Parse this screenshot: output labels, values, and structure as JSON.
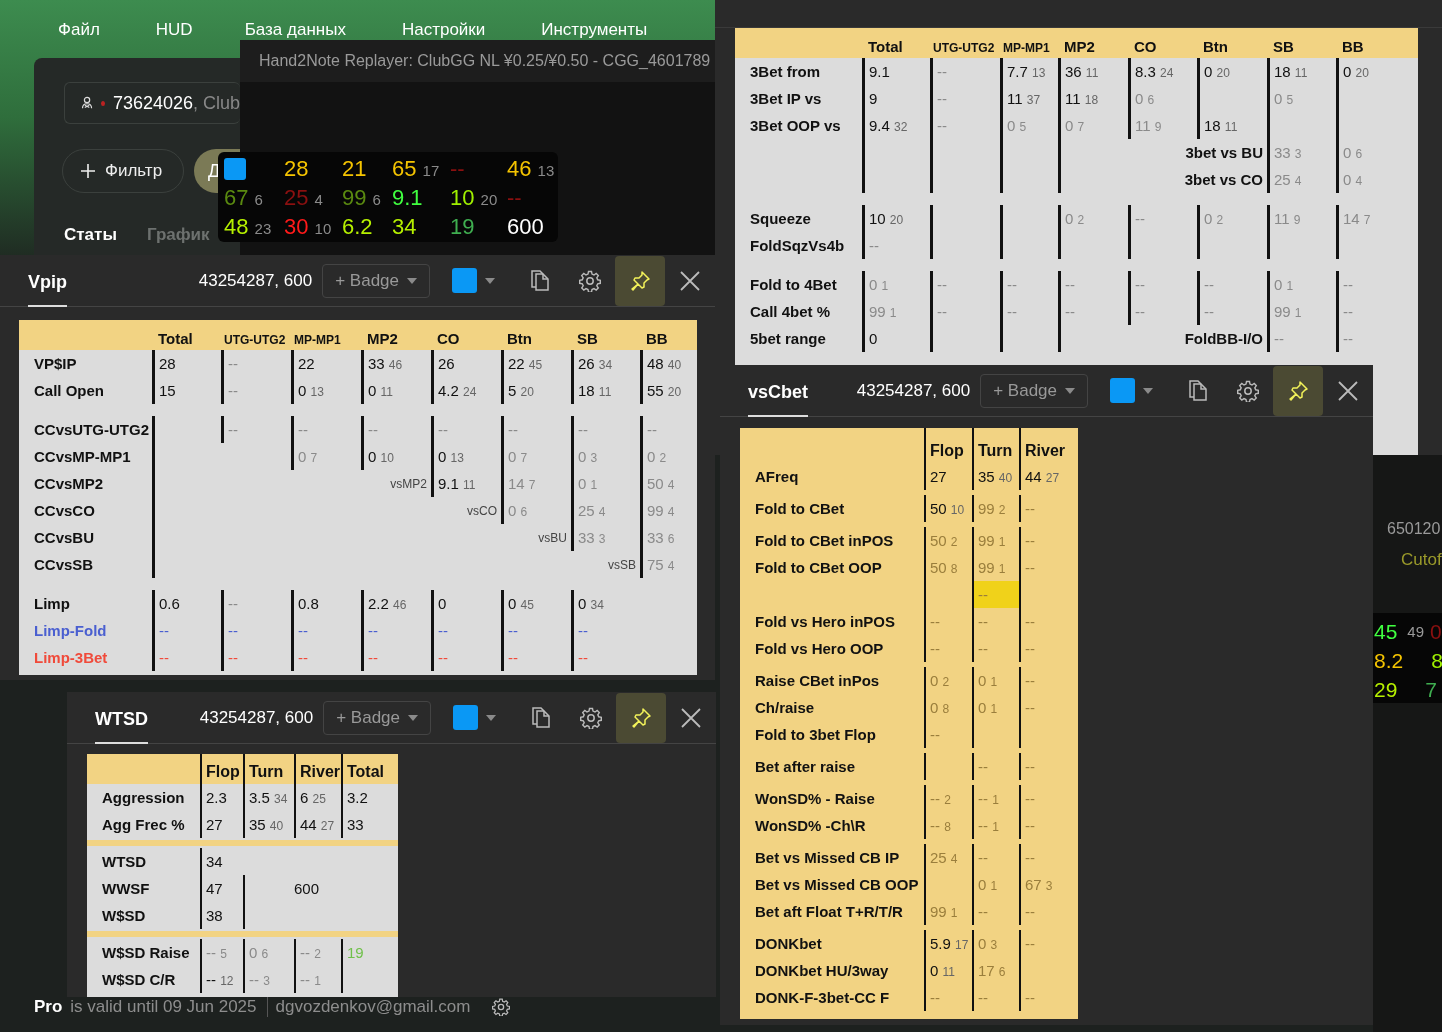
{
  "menu": [
    "Файл",
    "HUD",
    "База данных",
    "Настройки",
    "Инструменты"
  ],
  "player_panel": {
    "search": {
      "value": "73624026",
      "suffix": ", Club"
    },
    "filter_button": "Фильтр",
    "cut_button": "Д",
    "tabs": [
      {
        "label": "Статы",
        "selected": true
      },
      {
        "label": "График",
        "selected": false
      }
    ]
  },
  "replayer": {
    "title": "Hand2Note Replayer: ClubGG NL ¥0.25/¥0.50 - CGG_4601789"
  },
  "hud_popup": {
    "rows": [
      [
        {
          "kind": "swatch",
          "color": "#0a98f5"
        },
        {
          "kind": "stat",
          "v": "28",
          "color": "#f5c400"
        },
        {
          "kind": "stat",
          "v": "21",
          "color": "#f5c400"
        },
        {
          "kind": "stat",
          "v": "65",
          "n": "17",
          "color": "#f5c400"
        },
        {
          "kind": "stat",
          "v": "--",
          "color": "#8b1010"
        },
        {
          "kind": "stat",
          "v": "46",
          "n": "13",
          "color": "#f5c400"
        }
      ],
      [
        {
          "kind": "stat",
          "v": "67",
          "n": "6",
          "color": "#5a8a10"
        },
        {
          "kind": "stat",
          "v": "25",
          "n": "4",
          "color": "#8b1010"
        },
        {
          "kind": "stat",
          "v": "99",
          "n": "6",
          "color": "#5a8a10"
        },
        {
          "kind": "stat",
          "v": "9.1",
          "color": "#40ff40"
        },
        {
          "kind": "stat",
          "v": "10",
          "n": "20",
          "color": "#a0f000"
        },
        {
          "kind": "stat",
          "v": "--",
          "color": "#8b1010"
        }
      ],
      [
        {
          "kind": "stat",
          "v": "48",
          "n": "23",
          "color": "#b6f000"
        },
        {
          "kind": "stat",
          "v": "30",
          "n": "10",
          "color": "#ff1a1a"
        },
        {
          "kind": "stat",
          "v": "6.2",
          "color": "#b6f000"
        },
        {
          "kind": "stat",
          "v": "34",
          "color": "#b6f000"
        },
        {
          "kind": "stat",
          "v": "19",
          "color": "#3fae50"
        },
        {
          "kind": "stat",
          "v": "600",
          "color": "#ffffff"
        }
      ]
    ]
  },
  "background_hud": {
    "id": "650120",
    "position": "Cutof",
    "rows": [
      [
        {
          "v": "45",
          "color": "#40ff40"
        },
        {
          "v": "49",
          "color": "#9a9a9a"
        },
        {
          "v": "0",
          "color": "#8b1010"
        }
      ],
      [
        {
          "v": "8.2",
          "color": "#f5c400"
        },
        {
          "v": "8",
          "color": "#a0f000"
        }
      ],
      [
        {
          "v": "29",
          "color": "#b6f000"
        },
        {
          "v": "7",
          "color": "#3fae50"
        }
      ]
    ]
  },
  "windows": [
    {
      "table": {
        "columns": [
          {
            "label": "Total"
          },
          {
            "label": "UTG-UTG2"
          },
          {
            "label": "MP-MP1"
          },
          {
            "label": "MP2"
          },
          {
            "label": "CO"
          },
          {
            "label": "Btn"
          },
          {
            "label": "SB"
          },
          {
            "label": "BB"
          }
        ],
        "groups": [
          [
            {
              "label": "3Bet from",
              "cells": [
                {
                  "v": "9.1",
                  "dim": false
                },
                {
                  "v": "--",
                  "dim": true
                },
                {
                  "v": "7.7",
                  "n": "13",
                  "dim": false
                },
                {
                  "v": "36",
                  "n": "11",
                  "dim": false
                },
                {
                  "v": "8.3",
                  "n": "24",
                  "dim": false
                },
                {
                  "v": "0",
                  "n": "20",
                  "dim": false
                },
                {
                  "v": "18",
                  "n": "11",
                  "dim": false
                },
                {
                  "v": "0",
                  "n": "20",
                  "dim": false
                }
              ]
            },
            {
              "label": "3Bet IP vs",
              "cells": [
                {
                  "v": "9",
                  "dim": false
                },
                {
                  "v": "--",
                  "dim": true
                },
                {
                  "v": "11",
                  "n": "37",
                  "dim": false
                },
                {
                  "v": "11",
                  "n": "18",
                  "dim": false
                },
                {
                  "v": "0",
                  "n": "6",
                  "dim": true
                },
                {
                  "kind": "blank"
                },
                {
                  "v": "0",
                  "n": "5",
                  "dim": true
                },
                {
                  "kind": "blank"
                }
              ]
            },
            {
              "label": "3Bet OOP vs",
              "cells": [
                {
                  "v": "9.4",
                  "n": "32",
                  "dim": false
                },
                {
                  "v": "--",
                  "dim": true
                },
                {
                  "v": "0",
                  "n": "5",
                  "dim": true
                },
                {
                  "v": "0",
                  "n": "7",
                  "dim": true
                },
                {
                  "v": "11",
                  "n": "9",
                  "dim": true
                },
                {
                  "v": "18",
                  "n": "11",
                  "dim": false
                },
                {
                  "kind": "blank"
                },
                {
                  "kind": "blank"
                }
              ]
            },
            {
              "cells": [
                {
                  "kind": "blank"
                },
                {
                  "kind": "blank"
                },
                {
                  "kind": "blank"
                },
                {
                  "kind": "blank"
                },
                {
                  "kind": "caption",
                  "v": "3bet vs BU"
                },
                {
                  "v": "33",
                  "n": "3",
                  "dim": true
                },
                {
                  "v": "0",
                  "n": "6",
                  "dim": true
                }
              ]
            },
            {
              "cells": [
                {
                  "kind": "blank"
                },
                {
                  "kind": "blank"
                },
                {
                  "kind": "blank"
                },
                {
                  "kind": "blank"
                },
                {
                  "kind": "caption",
                  "v": "3bet vs CO"
                },
                {
                  "v": "25",
                  "n": "4",
                  "dim": true
                },
                {
                  "v": "0",
                  "n": "4",
                  "dim": true
                }
              ]
            }
          ],
          [
            {
              "label": "Squeeze",
              "cells": [
                {
                  "v": "10",
                  "n": "20",
                  "dim": false
                },
                {
                  "kind": "blank"
                },
                {
                  "kind": "blank"
                },
                {
                  "v": "0",
                  "n": "2",
                  "dim": true
                },
                {
                  "v": "--",
                  "dim": true
                },
                {
                  "v": "0",
                  "n": "2",
                  "dim": true
                },
                {
                  "v": "11",
                  "n": "9",
                  "dim": true
                },
                {
                  "v": "14",
                  "n": "7",
                  "dim": true
                }
              ]
            },
            {
              "label": "FoldSqzVs4b",
              "cells": [
                {
                  "v": "--",
                  "dim": true
                },
                {
                  "kind": "blank"
                },
                {
                  "kind": "blank"
                },
                {
                  "kind": "blank"
                },
                {
                  "kind": "blank"
                },
                {
                  "kind": "blank"
                },
                {
                  "kind": "blank"
                },
                {
                  "kind": "blank"
                }
              ]
            }
          ],
          [
            {
              "label": "Fold to 4Bet",
              "cells": [
                {
                  "v": "0",
                  "n": "1",
                  "dim": true
                },
                {
                  "v": "--",
                  "dim": true
                },
                {
                  "v": "--",
                  "dim": true
                },
                {
                  "v": "--",
                  "dim": true
                },
                {
                  "v": "--",
                  "dim": true
                },
                {
                  "v": "--",
                  "dim": true
                },
                {
                  "v": "0",
                  "n": "1",
                  "dim": true
                },
                {
                  "v": "--",
                  "dim": true
                }
              ]
            },
            {
              "label": "Call 4bet %",
              "cells": [
                {
                  "v": "99",
                  "n": "1",
                  "dim": true
                },
                {
                  "v": "--",
                  "dim": true
                },
                {
                  "v": "--",
                  "dim": true
                },
                {
                  "v": "--",
                  "dim": true
                },
                {
                  "v": "--",
                  "dim": true
                },
                {
                  "v": "--",
                  "dim": true
                },
                {
                  "v": "99",
                  "n": "1",
                  "dim": true
                },
                {
                  "v": "--",
                  "dim": true
                }
              ]
            },
            {
              "label": "5bet range",
              "cells": [
                {
                  "v": "0",
                  "dim": false
                },
                {
                  "kind": "blank"
                },
                {
                  "kind": "blank"
                },
                {
                  "kind": "blank"
                },
                {
                  "kind": "caption",
                  "v": "FoldBB-I/O"
                },
                {
                  "v": "--",
                  "dim": true
                },
                {
                  "v": "--",
                  "dim": true
                }
              ]
            }
          ]
        ]
      }
    },
    {
      "header": {
        "title": "Vpip",
        "info": "43254287, 600",
        "badge": "+ Badge",
        "color": "#0a98f5",
        "pinned": true
      },
      "table": {
        "columns": [
          {
            "label": "Total"
          },
          {
            "label": "UTG-UTG2"
          },
          {
            "label": "MP-MP1"
          },
          {
            "label": "MP2"
          },
          {
            "label": "CO"
          },
          {
            "label": "Btn"
          },
          {
            "label": "SB"
          },
          {
            "label": "BB"
          }
        ],
        "groups": [
          [
            {
              "label": "VP$IP",
              "cells": [
                {
                  "v": "28",
                  "dim": false
                },
                {
                  "v": "--",
                  "dim": true
                },
                {
                  "v": "22",
                  "dim": false
                },
                {
                  "v": "33",
                  "n": "46",
                  "dim": false
                },
                {
                  "v": "26",
                  "dim": false
                },
                {
                  "v": "22",
                  "n": "45",
                  "dim": false
                },
                {
                  "v": "26",
                  "n": "34",
                  "dim": false
                },
                {
                  "v": "48",
                  "n": "40",
                  "dim": false
                }
              ]
            },
            {
              "label": "Call Open",
              "cells": [
                {
                  "v": "15",
                  "dim": false
                },
                {
                  "v": "--",
                  "dim": true
                },
                {
                  "v": "0",
                  "n": "13",
                  "dim": false
                },
                {
                  "v": "0",
                  "n": "11",
                  "dim": false
                },
                {
                  "v": "4.2",
                  "n": "24",
                  "dim": false
                },
                {
                  "v": "5",
                  "n": "20",
                  "dim": false
                },
                {
                  "v": "18",
                  "n": "11",
                  "dim": false
                },
                {
                  "v": "55",
                  "n": "20",
                  "dim": false
                }
              ]
            }
          ],
          [
            {
              "label": "CCvsUTG-UTG2",
              "cells": [
                {
                  "kind": "blank"
                },
                {
                  "v": "--",
                  "dim": true
                },
                {
                  "v": "--",
                  "dim": true
                },
                {
                  "v": "--",
                  "dim": true
                },
                {
                  "v": "--",
                  "dim": true
                },
                {
                  "v": "--",
                  "dim": true
                },
                {
                  "v": "--",
                  "dim": true
                },
                {
                  "v": "--",
                  "dim": true
                }
              ]
            },
            {
              "label": "CCvsMP-MP1",
              "cells": [
                {
                  "kind": "blank"
                },
                null,
                {
                  "v": "0",
                  "n": "7",
                  "dim": true
                },
                {
                  "v": "0",
                  "n": "10",
                  "dim": false
                },
                {
                  "v": "0",
                  "n": "13",
                  "dim": false
                },
                {
                  "v": "0",
                  "n": "7",
                  "dim": true
                },
                {
                  "v": "0",
                  "n": "3",
                  "dim": true
                },
                {
                  "v": "0",
                  "n": "2",
                  "dim": true
                }
              ]
            },
            {
              "label": "CCvsMP2",
              "cells": [
                {
                  "kind": "blank"
                },
                null,
                null,
                {
                  "kind": "label",
                  "v": "vsMP2"
                },
                {
                  "v": "9.1",
                  "n": "11",
                  "dim": false
                },
                {
                  "v": "14",
                  "n": "7",
                  "dim": true
                },
                {
                  "v": "0",
                  "n": "1",
                  "dim": true
                },
                {
                  "v": "50",
                  "n": "4",
                  "dim": true
                }
              ]
            },
            {
              "label": "CCvsCO",
              "cells": [
                {
                  "kind": "blank"
                },
                null,
                null,
                null,
                {
                  "kind": "label",
                  "v": "vsCO"
                },
                {
                  "v": "0",
                  "n": "6",
                  "dim": true
                },
                {
                  "v": "25",
                  "n": "4",
                  "dim": true
                },
                {
                  "v": "99",
                  "n": "4",
                  "dim": true
                }
              ]
            },
            {
              "label": "CCvsBU",
              "cells": [
                {
                  "kind": "blank"
                },
                null,
                null,
                null,
                null,
                {
                  "kind": "label",
                  "v": "vsBU"
                },
                {
                  "v": "33",
                  "n": "3",
                  "dim": true
                },
                {
                  "v": "33",
                  "n": "6",
                  "dim": true
                }
              ]
            },
            {
              "label": "CCvsSB",
              "cells": [
                {
                  "kind": "blank"
                },
                null,
                null,
                null,
                null,
                null,
                {
                  "kind": "label",
                  "v": "vsSB"
                },
                {
                  "v": "75",
                  "n": "4",
                  "dim": true
                }
              ]
            }
          ],
          [
            {
              "label": "Limp",
              "cells": [
                {
                  "v": "0.6",
                  "dim": false
                },
                {
                  "v": "--",
                  "dim": true
                },
                {
                  "v": "0.8",
                  "dim": false
                },
                {
                  "v": "2.2",
                  "n": "46",
                  "dim": false
                },
                {
                  "v": "0",
                  "dim": false
                },
                {
                  "v": "0",
                  "n": "45",
                  "dim": false
                },
                {
                  "v": "0",
                  "n": "34",
                  "dim": false
                },
                null
              ]
            },
            {
              "label": "Limp-Fold",
              "color": "#4a5fd0",
              "cells": [
                {
                  "v": "--",
                  "dim": false
                },
                {
                  "v": "--",
                  "dim": false
                },
                {
                  "v": "--",
                  "dim": false
                },
                {
                  "v": "--",
                  "dim": false
                },
                {
                  "v": "--",
                  "dim": false
                },
                {
                  "v": "--",
                  "dim": false
                },
                {
                  "v": "--",
                  "dim": false
                },
                null
              ]
            },
            {
              "label": "Limp-3Bet",
              "color": "#f04a3a",
              "cells": [
                {
                  "v": "--",
                  "dim": false
                },
                {
                  "v": "--",
                  "dim": false
                },
                {
                  "v": "--",
                  "dim": false
                },
                {
                  "v": "--",
                  "dim": false
                },
                {
                  "v": "--",
                  "dim": false
                },
                {
                  "v": "--",
                  "dim": false
                },
                {
                  "v": "--",
                  "dim": false
                },
                null
              ]
            }
          ]
        ]
      }
    },
    {
      "header": {
        "title": "WTSD",
        "info": "43254287, 600",
        "badge": "+ Badge",
        "color": "#0a98f5",
        "pinned": true
      },
      "table": {
        "columns": [
          {
            "label": "Flop"
          },
          {
            "label": "Turn"
          },
          {
            "label": "River"
          },
          {
            "label": "Total"
          }
        ],
        "groups": [
          [
            {
              "label": "Aggression",
              "cells": [
                {
                  "v": "2.3",
                  "dim": false
                },
                {
                  "v": "3.5",
                  "n": "34",
                  "dim": false
                },
                {
                  "v": "6",
                  "n": "25",
                  "dim": false
                },
                {
                  "v": "3.2",
                  "dim": false
                }
              ]
            },
            {
              "label": "Agg Frec %",
              "cells": [
                {
                  "v": "27",
                  "dim": false
                },
                {
                  "v": "35",
                  "n": "40",
                  "dim": false
                },
                {
                  "v": "44",
                  "n": "27",
                  "dim": false
                },
                {
                  "v": "33",
                  "dim": false
                }
              ]
            }
          ],
          [
            {
              "label": "WTSD",
              "cells": [
                {
                  "v": "34",
                  "dim": false
                },
                null,
                null,
                null
              ]
            },
            {
              "label": "WWSF",
              "cells": [
                {
                  "v": "47",
                  "dim": false
                },
                {
                  "kind": "blank"
                },
                {
                  "kind": "text",
                  "v": "600"
                },
                null
              ]
            },
            {
              "label": "W$SD",
              "cells": [
                {
                  "v": "38",
                  "dim": false
                },
                {
                  "kind": "blank"
                },
                null,
                null
              ]
            }
          ],
          [
            {
              "label": "W$SD Raise",
              "cells": [
                {
                  "v": "--",
                  "n": "5",
                  "dim": true
                },
                {
                  "v": "0",
                  "n": "6",
                  "dim": true
                },
                {
                  "v": "--",
                  "n": "2",
                  "dim": true
                },
                {
                  "v": "19",
                  "color": "#6fc04a"
                }
              ]
            },
            {
              "label": "W$SD C/R",
              "cells": [
                {
                  "v": "--",
                  "n": "12",
                  "dim": false
                },
                {
                  "v": "--",
                  "n": "3",
                  "dim": true
                },
                {
                  "v": "--",
                  "n": "1",
                  "dim": true
                },
                {
                  "kind": "blank"
                }
              ]
            }
          ]
        ]
      }
    },
    {
      "header": {
        "title": "vsCbet",
        "info": "43254287, 600",
        "badge": "+ Badge",
        "color": "#0a98f5",
        "pinned": true
      },
      "table": {
        "columns": [
          {
            "label": "Flop"
          },
          {
            "label": "Turn"
          },
          {
            "label": "River"
          }
        ],
        "groups": [
          [
            {
              "label": "AFreq",
              "cells": [
                {
                  "v": "27",
                  "dim": false
                },
                {
                  "v": "35",
                  "n": "40",
                  "dim": false
                },
                {
                  "v": "44",
                  "n": "27",
                  "dim": false
                }
              ]
            }
          ],
          [
            {
              "label": "Fold to CBet",
              "cells": [
                {
                  "v": "50",
                  "n": "10",
                  "dim": false
                },
                {
                  "v": "99",
                  "n": "2",
                  "dim": true
                },
                {
                  "v": "--",
                  "dim": true
                }
              ]
            }
          ],
          [
            {
              "label": "Fold to CBet inPOS",
              "cells": [
                {
                  "v": "50",
                  "n": "2",
                  "dim": true
                },
                {
                  "v": "99",
                  "n": "1",
                  "dim": true
                },
                {
                  "v": "--",
                  "dim": true
                }
              ]
            },
            {
              "label": "Fold to CBet OOP",
              "cells": [
                {
                  "v": "50",
                  "n": "8",
                  "dim": true
                },
                {
                  "v": "99",
                  "n": "1",
                  "dim": true
                },
                {
                  "v": "--",
                  "dim": true
                }
              ]
            },
            {
              "cells": [
                {
                  "kind": "blank"
                },
                {
                  "v": "--",
                  "dim": true,
                  "highlight": true
                },
                {
                  "kind": "blank"
                }
              ]
            },
            {
              "label": "Fold vs Hero inPOS",
              "cells": [
                {
                  "v": "--",
                  "dim": true
                },
                {
                  "v": "--",
                  "dim": true
                },
                {
                  "v": "--",
                  "dim": true
                }
              ]
            },
            {
              "label": "Fold vs Hero OOP",
              "cells": [
                {
                  "v": "--",
                  "dim": true
                },
                {
                  "v": "--",
                  "dim": true
                },
                {
                  "v": "--",
                  "dim": true
                }
              ]
            }
          ],
          [
            {
              "label": "Raise CBet inPos",
              "cells": [
                {
                  "v": "0",
                  "n": "2",
                  "dim": true
                },
                {
                  "v": "0",
                  "n": "1",
                  "dim": true
                },
                {
                  "v": "--",
                  "dim": true
                }
              ]
            },
            {
              "label": "Ch/raise",
              "cells": [
                {
                  "v": "0",
                  "n": "8",
                  "dim": true
                },
                {
                  "v": "0",
                  "n": "1",
                  "dim": true
                },
                {
                  "v": "--",
                  "dim": true
                }
              ]
            },
            {
              "label": "Fold to 3bet Flop",
              "cells": [
                {
                  "v": "--",
                  "dim": true
                },
                {
                  "kind": "blank"
                },
                {
                  "kind": "blank"
                }
              ]
            }
          ],
          [
            {
              "label": "Bet after raise",
              "cells": [
                {
                  "kind": "blank"
                },
                {
                  "v": "--",
                  "dim": true
                },
                {
                  "v": "--",
                  "dim": true
                }
              ]
            }
          ],
          [
            {
              "label": "WonSD% - Raise",
              "cells": [
                {
                  "v": "--",
                  "n": "2",
                  "dim": true
                },
                {
                  "v": "--",
                  "n": "1",
                  "dim": true
                },
                {
                  "v": "--",
                  "dim": true
                }
              ]
            },
            {
              "label": "WonSD% -Ch\\R",
              "cells": [
                {
                  "v": "--",
                  "n": "8",
                  "dim": true
                },
                {
                  "v": "--",
                  "n": "1",
                  "dim": true
                },
                {
                  "v": "--",
                  "dim": true
                }
              ]
            }
          ],
          [
            {
              "label": "Bet vs Missed CB IP",
              "cells": [
                {
                  "v": "25",
                  "n": "4",
                  "dim": true
                },
                {
                  "v": "--",
                  "dim": true
                },
                {
                  "v": "--",
                  "dim": true
                }
              ]
            },
            {
              "label": "Bet vs Missed CB OOP",
              "cells": [
                {
                  "kind": "blank"
                },
                {
                  "v": "0",
                  "n": "1",
                  "dim": true
                },
                {
                  "v": "67",
                  "n": "3",
                  "dim": true
                }
              ]
            },
            {
              "label": "Bet aft Float T+R/T/R",
              "cells": [
                {
                  "v": "99",
                  "n": "1",
                  "dim": true
                },
                {
                  "v": "--",
                  "dim": true
                },
                {
                  "v": "--",
                  "dim": true
                }
              ]
            }
          ],
          [
            {
              "label": "DONKbet",
              "cells": [
                {
                  "v": "5.9",
                  "n": "17",
                  "dim": false
                },
                {
                  "v": "0",
                  "n": "3",
                  "dim": true
                },
                {
                  "v": "--",
                  "dim": true
                }
              ]
            },
            {
              "label": "DONKbet HU/3way",
              "cells": [
                {
                  "v": "0",
                  "n": "11",
                  "dim": false
                },
                {
                  "v": "17",
                  "n": "6",
                  "dim": true
                },
                {
                  "kind": "blank"
                }
              ]
            },
            {
              "label": "DONK-F-3bet-CC F",
              "cells": [
                {
                  "v": "--",
                  "dim": true
                },
                {
                  "v": "--",
                  "dim": true
                },
                {
                  "v": "--",
                  "dim": true
                }
              ]
            }
          ]
        ]
      }
    }
  ],
  "status_bar": {
    "plan": "Pro",
    "validity": "is valid until 09 Jun 2025",
    "email": "dgvozdenkov@gmail.com"
  }
}
